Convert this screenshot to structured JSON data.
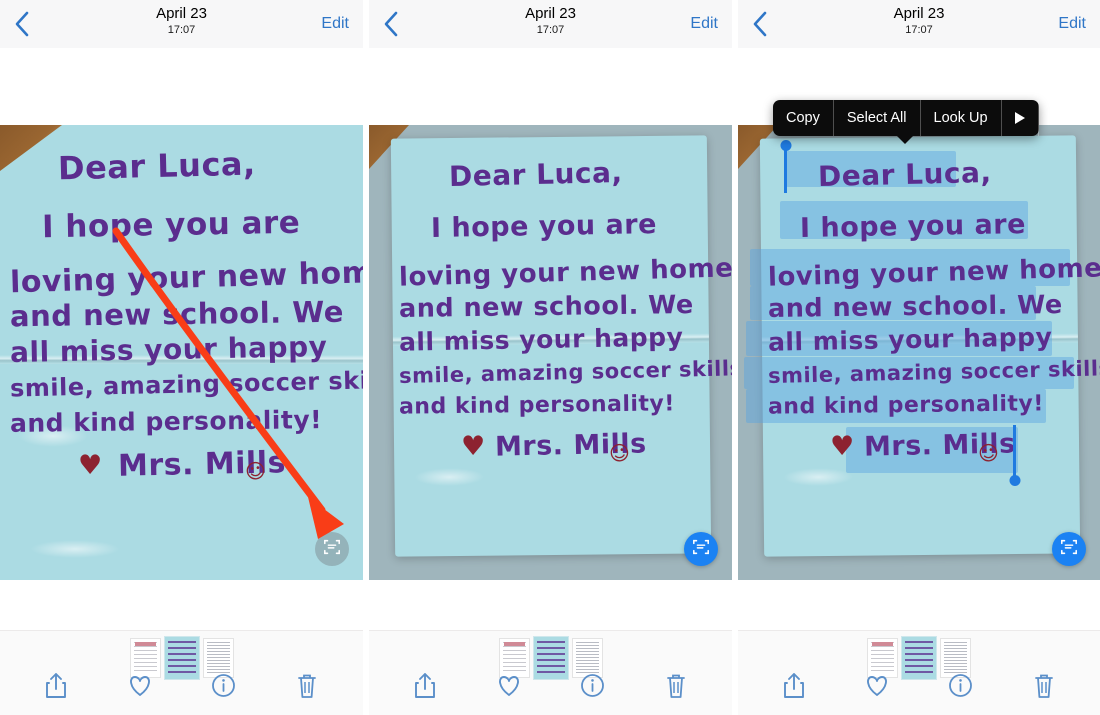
{
  "app": "Photos",
  "navbar": {
    "back_icon": "chevron-left-icon",
    "date": "April 23",
    "time": "17:07",
    "edit_label": "Edit"
  },
  "note": {
    "lines": [
      "Dear Luca,",
      "I hope you are",
      "loving your new home",
      "and new school. We",
      "all miss your  happy",
      "smile, amazing soccer skills,",
      "and kind personality!"
    ],
    "signature": "Mrs. Mills",
    "heart_glyph": "♥",
    "smiley_glyph": "☺",
    "paper_color": "#abdbe3",
    "ink_color": "#5b2d8e",
    "desk_color": "#9fb5bc"
  },
  "livetext": {
    "icon": "live-text-scan-icon",
    "inactive_color": "#7a8287",
    "active_color": "#1b82f3"
  },
  "annotation": {
    "arrow_color": "#f93d17",
    "arrow_icon": "curved-arrow-annotation"
  },
  "context_menu": {
    "items": [
      {
        "label": "Copy",
        "name": "copy"
      },
      {
        "label": "Select All",
        "name": "select-all"
      },
      {
        "label": "Look Up",
        "name": "look-up"
      }
    ],
    "more_icon": "triangle-right-icon"
  },
  "selection": {
    "highlight_color": "#58a5e1",
    "handle_color": "#1f7ae0"
  },
  "toolbar": {
    "items": [
      {
        "name": "share",
        "icon": "share-up-arrow-icon"
      },
      {
        "name": "favorite",
        "icon": "heart-outline-icon"
      },
      {
        "name": "info",
        "icon": "info-circle-icon"
      },
      {
        "name": "delete",
        "icon": "trash-icon"
      }
    ]
  },
  "filmstrip": {
    "thumbnails": [
      {
        "name": "thumb-letter-pink",
        "kind": "doc"
      },
      {
        "name": "thumb-blue-note",
        "kind": "note",
        "selected": true
      },
      {
        "name": "thumb-form-document",
        "kind": "form"
      }
    ]
  },
  "panels": [
    {
      "id": "panel-1",
      "state": "live-text-inactive-with-annotation"
    },
    {
      "id": "panel-2",
      "state": "live-text-active"
    },
    {
      "id": "panel-3",
      "state": "text-selected-with-menu"
    }
  ]
}
